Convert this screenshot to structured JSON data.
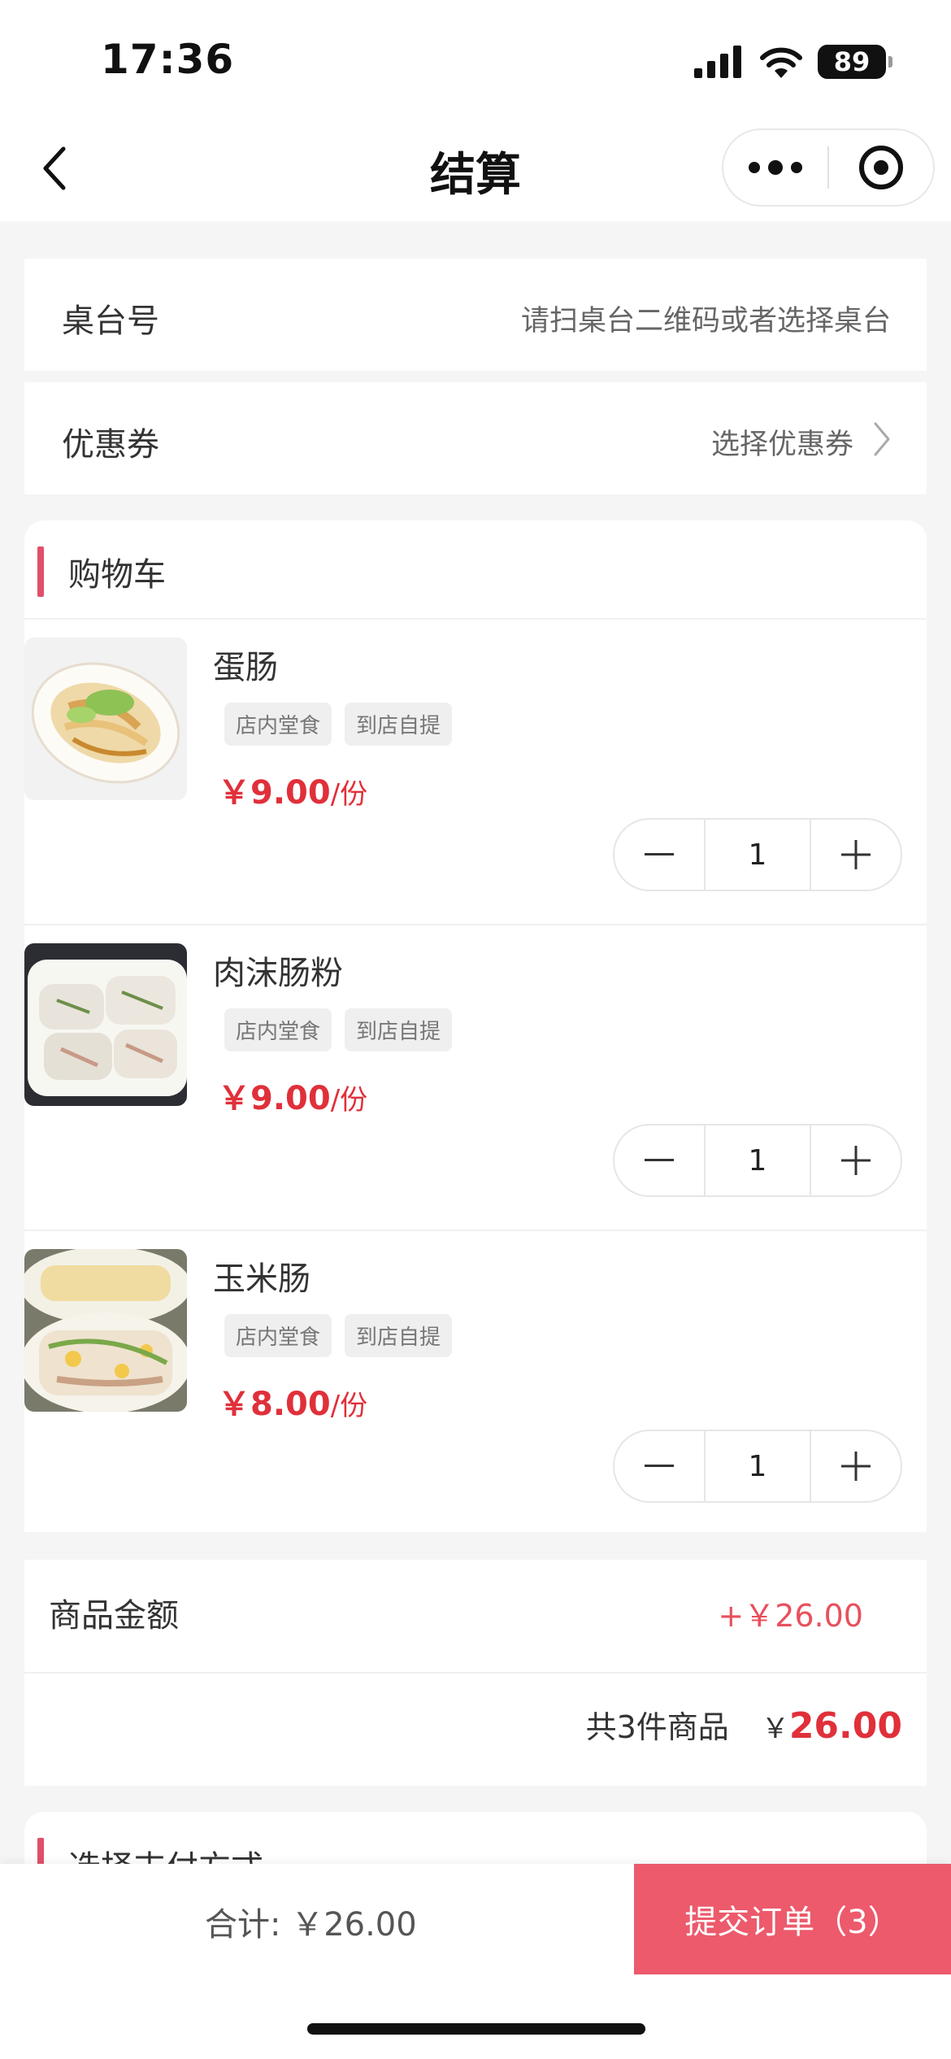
{
  "status": {
    "time": "17:36",
    "battery": "89"
  },
  "nav": {
    "title": "结算"
  },
  "table": {
    "label": "桌台号",
    "placeholder": "请扫桌台二维码或者选择桌台"
  },
  "coupon": {
    "label": "优惠券",
    "action": "选择优惠券"
  },
  "cart": {
    "title": "购物车",
    "items": [
      {
        "name": "蛋肠",
        "tags": [
          "店内堂食",
          "到店自提"
        ],
        "price": "￥9.00",
        "unit": "/份",
        "qty": "1"
      },
      {
        "name": "肉沫肠粉",
        "tags": [
          "店内堂食",
          "到店自提"
        ],
        "price": "￥9.00",
        "unit": "/份",
        "qty": "1"
      },
      {
        "name": "玉米肠",
        "tags": [
          "店内堂食",
          "到店自提"
        ],
        "price": "￥8.00",
        "unit": "/份",
        "qty": "1"
      }
    ]
  },
  "summary": {
    "goods_label": "商品金额",
    "goods_value": "+￥26.00",
    "count_text": "共3件商品",
    "currency": "￥",
    "total": "26.00"
  },
  "payment": {
    "title": "选择支付方式"
  },
  "footer": {
    "sum_text": "合计: ￥26.00",
    "submit_label": "提交订单（3）"
  },
  "colors": {
    "accent": "#e0303a",
    "button": "#ec5a6c",
    "section_bar": "#e0506a"
  }
}
